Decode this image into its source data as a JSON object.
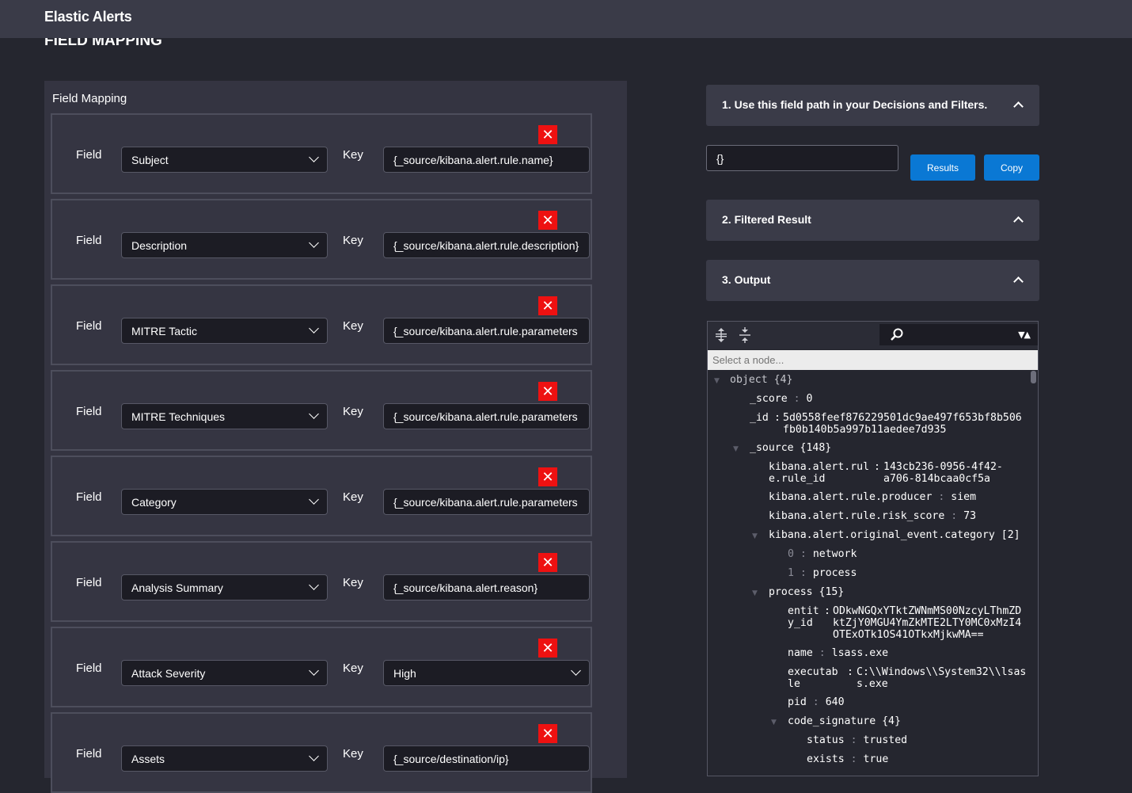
{
  "app": {
    "title": "Elastic Alerts"
  },
  "page": {
    "heading": "FIELD MAPPING"
  },
  "field_mapping": {
    "label": "Field Mapping",
    "field_label": "Field",
    "key_label": "Key",
    "delete_glyph": "✕",
    "rows": [
      {
        "field": "Subject",
        "key": "{_source/kibana.alert.rule.name}"
      },
      {
        "field": "Description",
        "key": "{_source/kibana.alert.rule.description}"
      },
      {
        "field": "MITRE Tactic",
        "key": "{_source/kibana.alert.rule.parameters"
      },
      {
        "field": "MITRE Techniques",
        "key": "{_source/kibana.alert.rule.parameters"
      },
      {
        "field": "Category",
        "key": "{_source/kibana.alert.rule.parameters"
      },
      {
        "field": "Analysis Summary",
        "key": "{_source/kibana.alert.reason}"
      },
      {
        "field": "Attack Severity",
        "key": "High"
      },
      {
        "field": "Assets",
        "key": "{_source/destination/ip}"
      }
    ]
  },
  "right": {
    "acc1": "1. Use this field path in your Decisions and Filters.",
    "path_value": "{}",
    "results_button": "Results",
    "copy_button": "Copy",
    "acc2": "2. Filtered Result",
    "acc3": "3. Output",
    "select_node_placeholder": "Select a node...",
    "tree": {
      "root": "object {4}",
      "score_key": "_score",
      "score_val": "0",
      "id_key": "_id",
      "id_val": "5d0558feef876229501dc9ae497f653bf8b506\nfb0b140b5a997b11aedee7d935",
      "source": "_source {148}",
      "rule_id_key": "kibana.alert.rul\ne.rule_id",
      "rule_id_val": "143cb236-0956-4f42-\na706-814bcaa0cf5a",
      "producer_key": "kibana.alert.rule.producer",
      "producer_val": "siem",
      "risk_key": "kibana.alert.rule.risk_score",
      "risk_val": "73",
      "category_node": "kibana.alert.original_event.category [2]",
      "cat0_idx": "0",
      "cat0_val": "network",
      "cat1_idx": "1",
      "cat1_val": "process",
      "process_node": "process {15}",
      "entity_key": "entit\ny_id",
      "entity_val": "ODkwNGQxYTktZWNmMS00NzcyLThmZD\nktZjY0MGU4YmZkMTE2LTY0MC0xMzI4\nOTExOTk1OS41OTkxMjkwMA==",
      "name_key": "name",
      "name_val": "lsass.exe",
      "exec_key": "executab\nle",
      "exec_val": "C:\\\\Windows\\\\System32\\\\lsas\ns.exe",
      "pid_key": "pid",
      "pid_val": "640",
      "codesig_node": "code_signature {4}",
      "status_key": "status",
      "status_val": "trusted",
      "exists_key": "exists",
      "exists_val": "true"
    }
  }
}
